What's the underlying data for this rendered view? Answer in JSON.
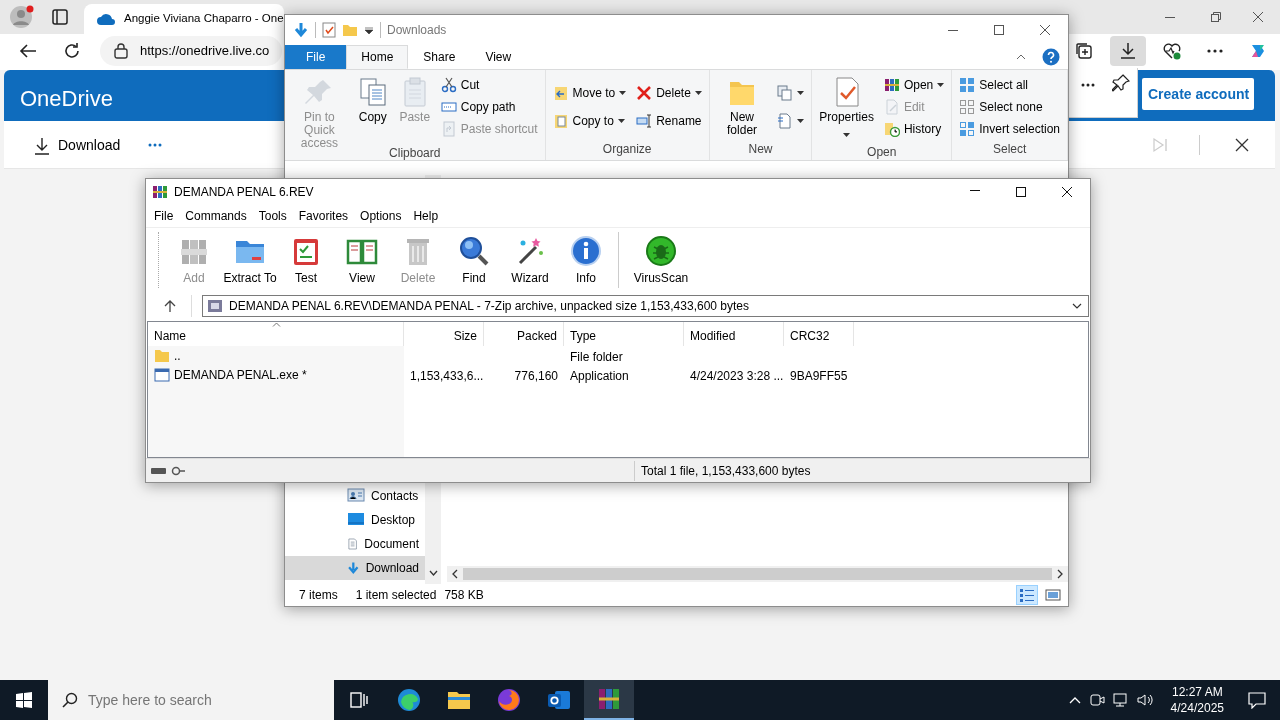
{
  "browser": {
    "tab_title": "Anggie Viviana Chaparro - One",
    "url": "https://onedrive.live.co",
    "toolbar_buttons": [
      {
        "selected": false
      },
      {
        "selected": true
      },
      {
        "selected": false
      },
      {
        "selected": false
      },
      {
        "selected": false
      }
    ],
    "page": {
      "app_name": "OneDrive",
      "create_account": "Create account",
      "download": "Download"
    }
  },
  "explorer": {
    "title": "Downloads",
    "tabs": [
      {
        "label": "File",
        "kind": "file",
        "selected": false
      },
      {
        "label": "Home",
        "kind": "tab",
        "selected": true
      },
      {
        "label": "Share",
        "kind": "tab",
        "selected": false
      },
      {
        "label": "View",
        "kind": "tab",
        "selected": false
      }
    ],
    "groups": [
      {
        "label": "Clipboard",
        "stacks": [
          {
            "kind": "large",
            "items": [
              {
                "label": "Pin to Quick access",
                "disabled": true
              }
            ]
          },
          {
            "kind": "large",
            "items": [
              {
                "label": "Copy",
                "disabled": false
              }
            ]
          },
          {
            "kind": "large",
            "items": [
              {
                "label": "Paste",
                "disabled": true
              }
            ]
          },
          {
            "kind": "small",
            "items": [
              {
                "label": "Cut",
                "disabled": false
              },
              {
                "label": "Copy path",
                "disabled": false
              },
              {
                "label": "Paste shortcut",
                "disabled": true
              }
            ]
          }
        ]
      },
      {
        "label": "Organize",
        "stacks": [
          {
            "kind": "small",
            "items": [
              {
                "label": "Move to",
                "disabled": false,
                "dropdown": true
              },
              {
                "label": "Copy to",
                "disabled": false,
                "dropdown": true
              }
            ]
          },
          {
            "kind": "small",
            "items": [
              {
                "label": "Delete",
                "disabled": false,
                "dropdown": true
              },
              {
                "label": "Rename",
                "disabled": false
              }
            ]
          }
        ]
      },
      {
        "label": "New",
        "stacks": [
          {
            "kind": "large",
            "items": [
              {
                "label": "New folder",
                "disabled": false
              }
            ]
          },
          {
            "kind": "small",
            "items": [
              {
                "disabled": false,
                "dropdown": true
              },
              {
                "disabled": false,
                "dropdown": true
              }
            ]
          }
        ]
      },
      {
        "label": "Open",
        "stacks": [
          {
            "kind": "large",
            "items": [
              {
                "label": "Properties",
                "disabled": false,
                "dropdown": true
              }
            ]
          },
          {
            "kind": "small",
            "items": [
              {
                "label": "Open",
                "disabled": false,
                "dropdown": true
              },
              {
                "label": "Edit",
                "disabled": true
              },
              {
                "label": "History",
                "disabled": false
              }
            ]
          }
        ]
      },
      {
        "label": "Select",
        "stacks": [
          {
            "kind": "small",
            "items": [
              {
                "label": "Select all",
                "disabled": false
              },
              {
                "label": "Select none",
                "disabled": false
              },
              {
                "label": "Invert selection",
                "disabled": false
              }
            ]
          }
        ]
      }
    ],
    "nav_items": [
      {
        "label": "Contacts",
        "selected": false
      },
      {
        "label": "Desktop",
        "selected": false
      },
      {
        "label": "Document",
        "selected": false
      },
      {
        "label": "Download",
        "selected": true
      }
    ],
    "status": {
      "item_count": "7 items",
      "selection": "1 item selected",
      "selection_size": "758 KB"
    },
    "view_buttons": [
      {
        "selected": true
      },
      {
        "selected": false
      }
    ]
  },
  "winrar": {
    "title": "DEMANDA PENAL 6.REV",
    "menu": [
      "File",
      "Commands",
      "Tools",
      "Favorites",
      "Options",
      "Help"
    ],
    "tools": [
      {
        "label": "Add",
        "disabled": true
      },
      {
        "label": "Extract To",
        "disabled": false
      },
      {
        "label": "Test",
        "disabled": false
      },
      {
        "label": "View",
        "disabled": false
      },
      {
        "label": "Delete",
        "disabled": true
      },
      {
        "label": "Find",
        "disabled": false
      },
      {
        "label": "Wizard",
        "disabled": false
      },
      {
        "label": "Info",
        "disabled": false
      }
    ],
    "extra_tools": [
      {
        "label": "VirusScan",
        "disabled": false
      }
    ],
    "path": "DEMANDA PENAL 6.REV\\DEMANDA PENAL - 7-Zip archive, unpacked size 1,153,433,600 bytes",
    "columns": [
      "Name",
      "Size",
      "Packed",
      "Type",
      "Modified",
      "CRC32"
    ],
    "rows": [
      {
        "kind": "folder",
        "selected": false,
        "name": "..",
        "type": "File folder"
      },
      {
        "kind": "file",
        "selected": false,
        "name": "DEMANDA PENAL.exe *",
        "size": "1,153,433,6...",
        "packed": "776,160",
        "type": "Application",
        "modified": "4/24/2023 3:28 ...",
        "crc32": "9BA9FF55"
      }
    ],
    "status": "Total 1 file, 1,153,433,600 bytes"
  },
  "taskbar": {
    "search_placeholder": "Type here to search",
    "apps": [
      {
        "selected": false
      },
      {
        "selected": false
      },
      {
        "selected": false
      },
      {
        "selected": false
      },
      {
        "selected": true
      }
    ],
    "time": "12:27 AM",
    "date": "4/24/2025"
  }
}
